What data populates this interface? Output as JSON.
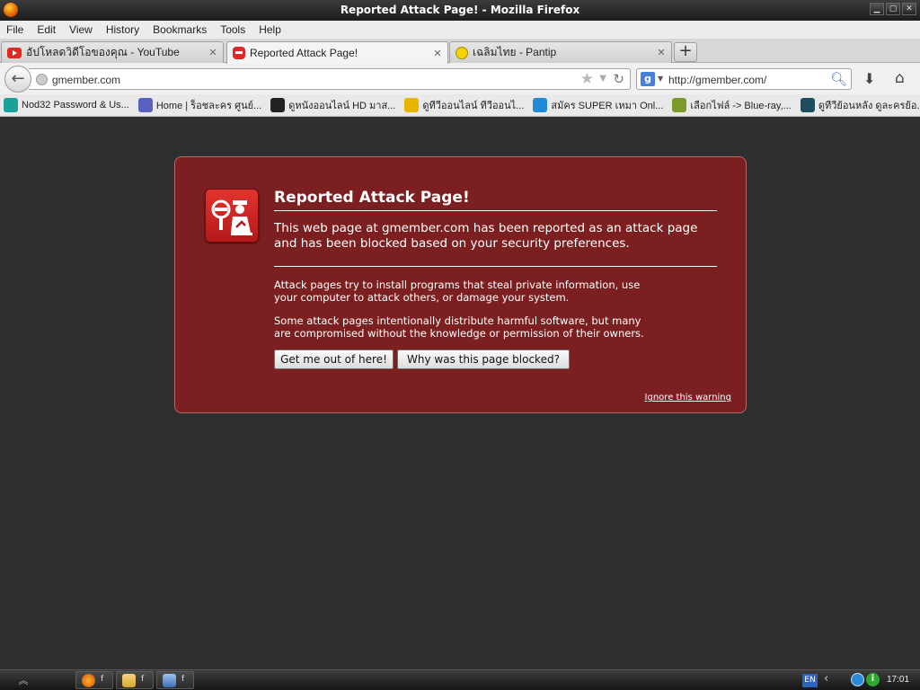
{
  "window": {
    "title": "Reported Attack Page! - Mozilla Firefox"
  },
  "menu": [
    "File",
    "Edit",
    "View",
    "History",
    "Bookmarks",
    "Tools",
    "Help"
  ],
  "tabs": [
    {
      "label": "อัปโหลดวิดีโอของคุณ - YouTube",
      "icon": "youtube-icon",
      "active": false
    },
    {
      "label": "Reported Attack Page!",
      "icon": "attack-page-icon",
      "active": true
    },
    {
      "label": "เฉลิมไทย - Pantip",
      "icon": "smiley-icon",
      "active": false
    }
  ],
  "new_tab_label": "+",
  "navbar": {
    "url": "gmember.com",
    "search_engine": "g",
    "search_text": "http://gmember.com/"
  },
  "bookmarks": [
    {
      "label": "Nod32 Password & Us...",
      "icon": "nod32-icon",
      "color": "#1aa19a"
    },
    {
      "label": "Home | ร็อชละคร ศูนย์...",
      "icon": "w-logo-icon",
      "color": "#5b5fbf"
    },
    {
      "label": "ดูหนังออนไลน์ HD มาส...",
      "icon": "hd-icon",
      "color": "#222222"
    },
    {
      "label": "ดูทีวีออนไลน์ ทีวีออนไ...",
      "icon": "tv-icon",
      "color": "#e8b400"
    },
    {
      "label": "สมัคร SUPER เหมา Onl...",
      "icon": "dtac-icon",
      "color": "#1f8ad6"
    },
    {
      "label": "เลือกไฟล์ -> Blue-ray,...",
      "icon": "leaf-icon",
      "color": "#7a9a2a"
    },
    {
      "label": "ดูทีวีย้อนหลัง ดูละครย้อ...",
      "icon": "turtle-icon",
      "color": "#1f4f5f"
    }
  ],
  "error": {
    "title": "Reported Attack Page!",
    "short_desc": "This web page at gmember.com has been reported as an attack page and has been blocked based on your security preferences.",
    "long_desc_1": "Attack pages try to install programs that steal private information, use your computer to attack others, or damage your system.",
    "long_desc_2": "Some attack pages intentionally distribute harmful software, but many are compromised without the knowledge or permission of their owners.",
    "button_get_out": "Get me out of here!",
    "button_why": "Why was this page blocked?",
    "ignore_link": "Ignore this warning",
    "bg_color": "#7b1f20"
  },
  "taskbar": {
    "apps": [
      {
        "icon": "firefox-icon",
        "label": "f"
      },
      {
        "icon": "folder-icon",
        "label": "f"
      },
      {
        "icon": "computer-icon",
        "label": "f"
      }
    ],
    "language": "EN",
    "clock": "17:01"
  }
}
